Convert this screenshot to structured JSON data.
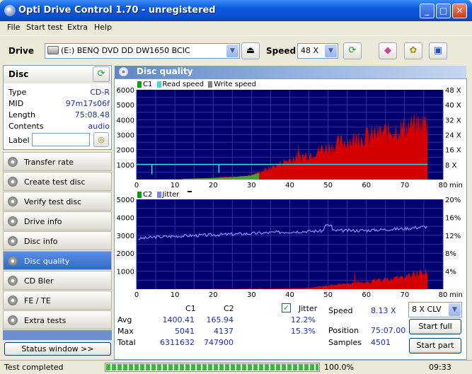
{
  "window": {
    "title": "Opti Drive Control 1.70 - unregistered"
  },
  "menu": [
    "File",
    "Start test",
    "Extra",
    "Help"
  ],
  "toolbar": {
    "drive_label": "Drive",
    "drive_value": "(E:)  BENQ DVD DD DW1650 BCIC",
    "speed_label": "Speed",
    "speed_value": "48 X"
  },
  "disc": {
    "title": "Disc",
    "type_label": "Type",
    "type_value": "CD-R",
    "mid_label": "MID",
    "mid_value": "97m17s06f",
    "length_label": "Length",
    "length_value": "75:08.48",
    "contents_label": "Contents",
    "contents_value": "audio",
    "label_label": "Label",
    "label_value": ""
  },
  "nav": [
    "Transfer rate",
    "Create test disc",
    "Verify test disc",
    "Drive info",
    "Disc info",
    "Disc quality",
    "CD Bler",
    "FE / TE",
    "Extra tests"
  ],
  "nav_active": 5,
  "status_window_button": "Status window >>",
  "panel": {
    "title": "Disc quality"
  },
  "chart_data": [
    {
      "type": "area",
      "legend": [
        "C1",
        "Read speed",
        "Write speed"
      ],
      "colors": {
        "C1": "#cc0000",
        "read_speed": "#40d8d8",
        "write_speed": "#808080"
      },
      "x_ticks": [
        0,
        10,
        20,
        30,
        40,
        50,
        60,
        70,
        80
      ],
      "x_unit": "min",
      "xlim": [
        0,
        80
      ],
      "y_left_ticks": [
        1000,
        2000,
        3000,
        4000,
        5000,
        6000
      ],
      "ylim": [
        0,
        6000
      ],
      "y_right_ticks": [
        "8 X",
        "16 X",
        "24 X",
        "32 X",
        "40 X",
        "48 X"
      ],
      "series": {
        "C1_envelope_x": [
          0,
          10,
          20,
          25,
          30,
          35,
          40,
          45,
          50,
          55,
          60,
          65,
          70,
          75
        ],
        "C1_envelope_y": [
          20,
          40,
          120,
          180,
          300,
          800,
          1350,
          1700,
          2200,
          2600,
          2900,
          3200,
          3500,
          3800
        ],
        "read_speed_x": 8.13
      }
    },
    {
      "type": "area",
      "legend": [
        "C2",
        "Jitter"
      ],
      "colors": {
        "C2": "#cc0000",
        "jitter": "#8080ff"
      },
      "x_ticks": [
        0,
        10,
        20,
        30,
        40,
        50,
        60,
        70,
        80
      ],
      "x_unit": "min",
      "xlim": [
        0,
        80
      ],
      "y_left_ticks": [
        1000,
        2000,
        3000,
        4000,
        5000
      ],
      "ylim": [
        0,
        5000
      ],
      "y_right_ticks": [
        "4%",
        "8%",
        "12%",
        "16%",
        "20%"
      ],
      "series": {
        "jitter_x": [
          0,
          5,
          10,
          20,
          30,
          40,
          50,
          60,
          70,
          75
        ],
        "jitter_y": [
          11.2,
          11.6,
          11.8,
          12.1,
          12.4,
          12.8,
          13.0,
          13.1,
          13.5,
          13.9
        ],
        "C2_envelope_x": [
          0,
          30,
          40,
          45,
          50,
          55,
          60,
          65,
          70,
          75
        ],
        "C2_envelope_y": [
          0,
          20,
          40,
          80,
          200,
          300,
          400,
          550,
          700,
          1000
        ]
      }
    }
  ],
  "stats": {
    "col_c1": "C1",
    "col_c2": "C2",
    "avg_label": "Avg",
    "avg_c1": "1400.41",
    "avg_c2": "165.94",
    "max_label": "Max",
    "max_c1": "5041",
    "max_c2": "4137",
    "total_label": "Total",
    "total_c1": "6311632",
    "total_c2": "747900",
    "jitter_label": "Jitter",
    "jitter_avg": "12.2%",
    "jitter_max": "15.3%",
    "speed_label": "Speed",
    "speed_value": "8.13 X",
    "position_label": "Position",
    "position_value": "75:07.00",
    "samples_label": "Samples",
    "samples_value": "4501",
    "speed_mode": "8 X CLV",
    "start_full": "Start full",
    "start_part": "Start part"
  },
  "status": {
    "text": "Test completed",
    "progress": 100.0,
    "progress_text": "100.0%",
    "time": "09:33"
  }
}
